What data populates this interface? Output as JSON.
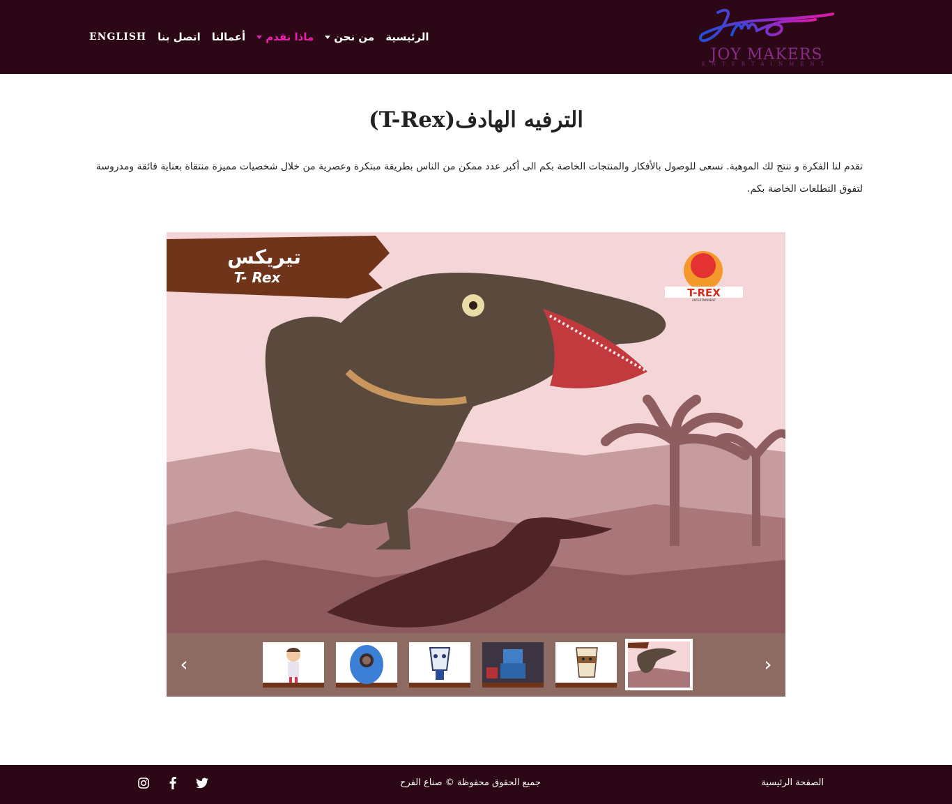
{
  "header": {
    "logo": {
      "script": "jme",
      "name": "JOY MAKERS",
      "tagline": "ENTERTAINMENT"
    },
    "nav": [
      {
        "label": "الرئيسية",
        "has_dropdown": false,
        "active": false
      },
      {
        "label": "من نحن",
        "has_dropdown": true,
        "active": false
      },
      {
        "label": "ماذا نقدم",
        "has_dropdown": true,
        "active": true
      },
      {
        "label": "أعمالنا",
        "has_dropdown": false,
        "active": false
      },
      {
        "label": "اتصل بنا",
        "has_dropdown": false,
        "active": false
      },
      {
        "label": "ENGLISH",
        "has_dropdown": false,
        "active": false
      }
    ],
    "colors": {
      "bar": "#2c0715",
      "active": "#f01fb4"
    }
  },
  "main": {
    "title": "الترفيه الهادف(T-Rex)",
    "intro": "تقدم لنا الفكرة و ننتج لك الموهبة. نسعى للوصول بالأفكار والمنتجات الخاصة بكم الى أكبر عدد ممكن من الناس بطريقة مبتكرة وعصرية من خلال شخصيات مميزة منتقاة بعناية فائقة ومدروسة لتفوق التطلعات الخاصة بكم."
  },
  "gallery": {
    "main_image": {
      "banner_ar": "تيريكس",
      "banner_en": "T- Rex",
      "badge": "T-REX",
      "badge_sub": "ENTERTAINMENT"
    },
    "prev_label": "‹",
    "next_label": "›",
    "thumbnails": [
      {
        "alt": "girl-mascot"
      },
      {
        "alt": "blue-mascot"
      },
      {
        "alt": "cup-mascot"
      },
      {
        "alt": "robot-mascot"
      },
      {
        "alt": "coffee-mascot"
      },
      {
        "alt": "trex-mascot"
      }
    ],
    "selected_index": 5
  },
  "footer": {
    "home_link": "الصفحة الرئيسية",
    "copyright": "جميع الحقوق محفوظة © صناع الفرح",
    "social": [
      "twitter-icon",
      "facebook-icon",
      "instagram-icon"
    ]
  }
}
